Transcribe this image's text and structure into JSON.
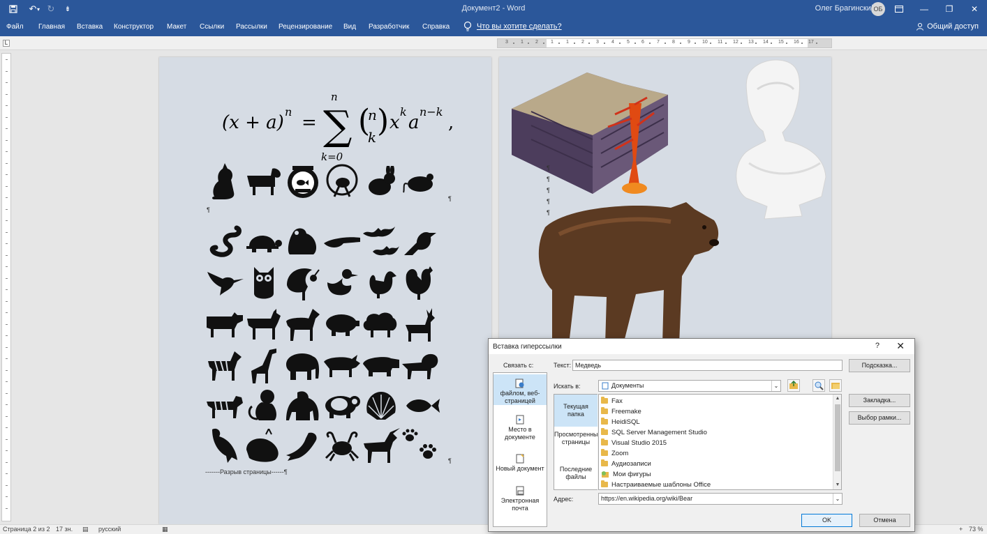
{
  "titlebar": {
    "document_title": "Документ2 - Word",
    "user_name": "Олег Брагинский",
    "avatar_initials": "ОБ"
  },
  "ribbon": {
    "tabs": [
      "Файл",
      "Главная",
      "Вставка",
      "Конструктор",
      "Макет",
      "Ссылки",
      "Рассылки",
      "Рецензирование",
      "Вид",
      "Разработчик",
      "Справка"
    ],
    "tell_me": "Что вы хотите сделать?",
    "share": "Общий доступ"
  },
  "ruler": {
    "corner": "L",
    "labels": [
      "3",
      "1",
      "2",
      "1",
      "1",
      "2",
      "3",
      "4",
      "5",
      "6",
      "7",
      "8",
      "9",
      "10",
      "11",
      "12",
      "13",
      "14",
      "15",
      "16",
      "17"
    ]
  },
  "document": {
    "page_break": "-------Разрыв страницы------¶",
    "pilcrow": "¶"
  },
  "statusbar": {
    "page": "Страница 2 из 2",
    "chars": "17 зн.",
    "language": "русский",
    "zoom": "73 %"
  },
  "dialog": {
    "title": "Вставка гиперссылки",
    "help": "?",
    "close": "✕",
    "link_to_label": "Связать с:",
    "link_to": [
      {
        "label": "файлом, веб-страницей",
        "selected": true
      },
      {
        "label": "Место в документе",
        "selected": false
      },
      {
        "label": "Новый документ",
        "selected": false
      },
      {
        "label": "Электронная почта",
        "selected": false
      }
    ],
    "text_label": "Текст:",
    "text_value": "Медведь",
    "look_in_label": "Искать в:",
    "look_in_value": "Документы",
    "subtabs": [
      {
        "label": "Текущая папка",
        "selected": true
      },
      {
        "label": "Просмотренные страницы",
        "selected": false
      },
      {
        "label": "Последние файлы",
        "selected": false
      }
    ],
    "files": [
      "Fax",
      "Freemake",
      "HeidiSQL",
      "SQL Server Management Studio",
      "Visual Studio 2015",
      "Zoom",
      "Аудиозаписи",
      "Мои фигуры",
      "Настраиваемые шаблоны Office"
    ],
    "address_label": "Адрес:",
    "address_value": "https://en.wikipedia.org/wiki/Bear",
    "buttons": {
      "screentip": "Подсказка...",
      "bookmark": "Закладка...",
      "target_frame": "Выбор рамки...",
      "ok": "OK",
      "cancel": "Отмена"
    }
  }
}
